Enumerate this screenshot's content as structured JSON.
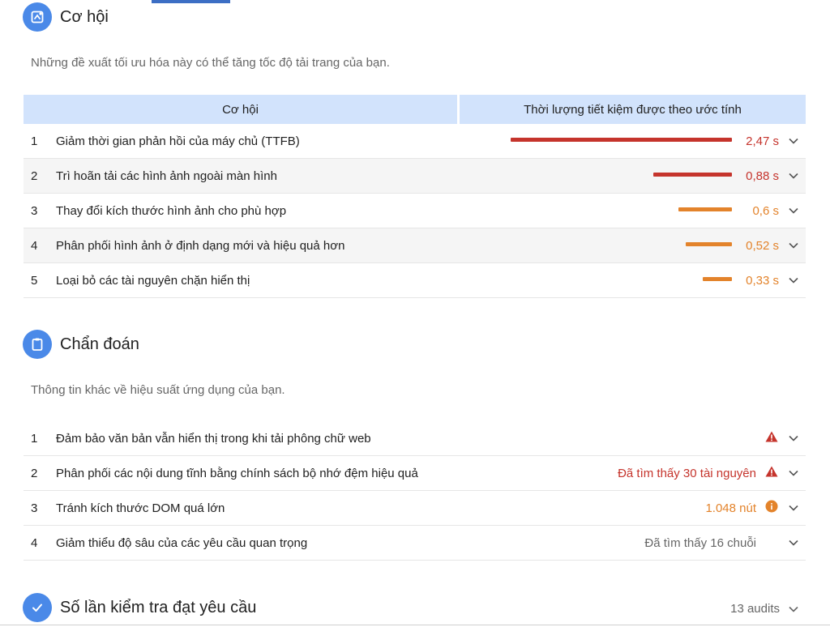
{
  "colors": {
    "accent": "#4a89e8",
    "fail": "#c5342c",
    "average": "#e3832b",
    "muted": "#666666",
    "header_bg": "#d2e3fc"
  },
  "opportunities": {
    "icon": "speed-opportunity-icon",
    "title": "Cơ hội",
    "description": "Những đề xuất tối ưu hóa này có thể tăng tốc độ tải trang của bạn.",
    "col_opportunity": "Cơ hội",
    "col_savings": "Thời lượng tiết kiệm được theo ước tính",
    "items": [
      {
        "num": "1",
        "label": "Giảm thời gian phản hồi của máy chủ (TTFB)",
        "value": "2,47 s",
        "seconds": 2.47,
        "severity": "fail"
      },
      {
        "num": "2",
        "label": "Trì hoãn tải các hình ảnh ngoài màn hình",
        "value": "0,88 s",
        "seconds": 0.88,
        "severity": "fail"
      },
      {
        "num": "3",
        "label": "Thay đổi kích thước hình ảnh cho phù hợp",
        "value": "0,6 s",
        "seconds": 0.6,
        "severity": "average"
      },
      {
        "num": "4",
        "label": "Phân phối hình ảnh ở định dạng mới và hiệu quả hơn",
        "value": "0,52 s",
        "seconds": 0.52,
        "severity": "average"
      },
      {
        "num": "5",
        "label": "Loại bỏ các tài nguyên chặn hiển thị",
        "value": "0,33 s",
        "seconds": 0.33,
        "severity": "average"
      }
    ]
  },
  "diagnostics": {
    "icon": "clipboard-icon",
    "title": "Chẩn đoán",
    "description": "Thông tin khác về hiệu suất ứng dụng của bạn.",
    "items": [
      {
        "num": "1",
        "label": "Đảm bảo văn bản vẫn hiển thị trong khi tải phông chữ web",
        "value": "",
        "status": "fail"
      },
      {
        "num": "2",
        "label": "Phân phối các nội dung tĩnh bằng chính sách bộ nhớ đệm hiệu quả",
        "value": "Đã tìm thấy 30 tài nguyên",
        "status": "fail"
      },
      {
        "num": "3",
        "label": "Tránh kích thước DOM quá lớn",
        "value": "1.048 nút",
        "status": "average"
      },
      {
        "num": "4",
        "label": "Giảm thiểu độ sâu của các yêu cầu quan trọng",
        "value": "Đã tìm thấy 16 chuỗi",
        "status": "info"
      }
    ]
  },
  "passed": {
    "icon": "checkmark-icon",
    "title": "Số lần kiểm tra đạt yêu cầu",
    "count": "13 audits"
  }
}
